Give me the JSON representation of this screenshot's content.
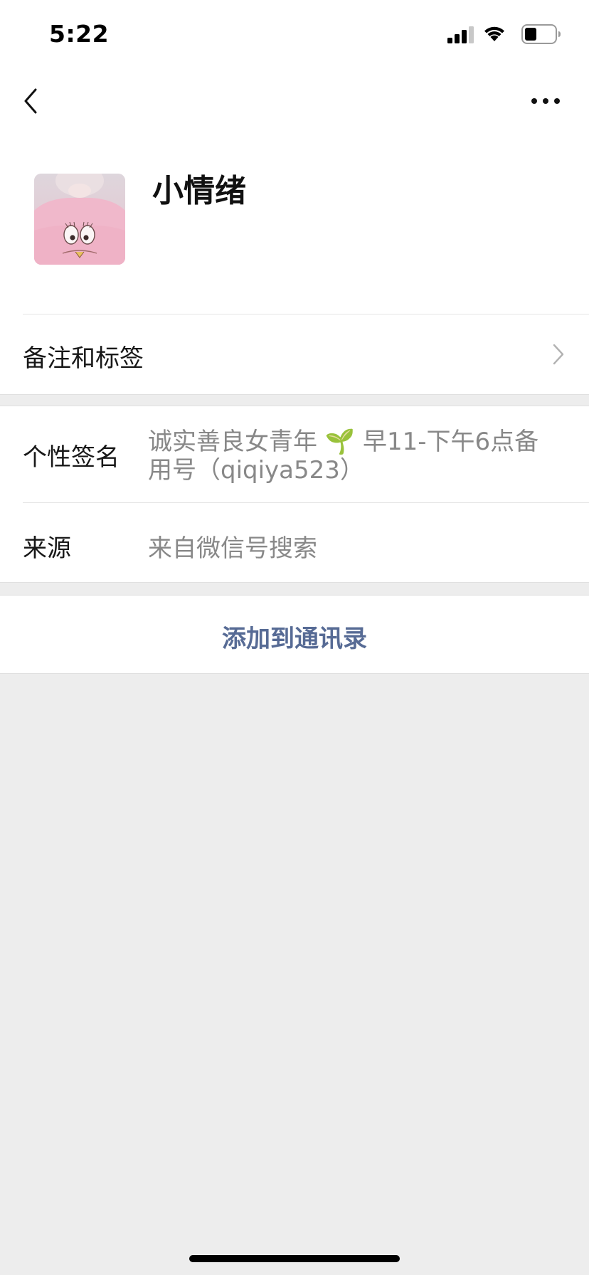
{
  "status_bar": {
    "time": "5:22",
    "icons": [
      "signal-icon",
      "wifi-icon",
      "battery-icon"
    ],
    "battery_level": 0.4
  },
  "navbar": {
    "back_icon": "chevron-left-icon",
    "more_icon": "more-dots-icon"
  },
  "profile": {
    "name": "小情绪",
    "avatar": "avatar-photo"
  },
  "remark_row": {
    "label": "备注和标签",
    "icon": "chevron-right-icon"
  },
  "signature": {
    "label": "个性签名",
    "value": "诚实善良女青年 🌱 早11-下午6点备用号（qiqiya523）"
  },
  "source": {
    "label": "来源",
    "value": "来自微信号搜索"
  },
  "add_button": {
    "label": "添加到通讯录"
  },
  "colors": {
    "link": "#576b95",
    "background": "#ededed",
    "secondary_text": "#888888"
  }
}
